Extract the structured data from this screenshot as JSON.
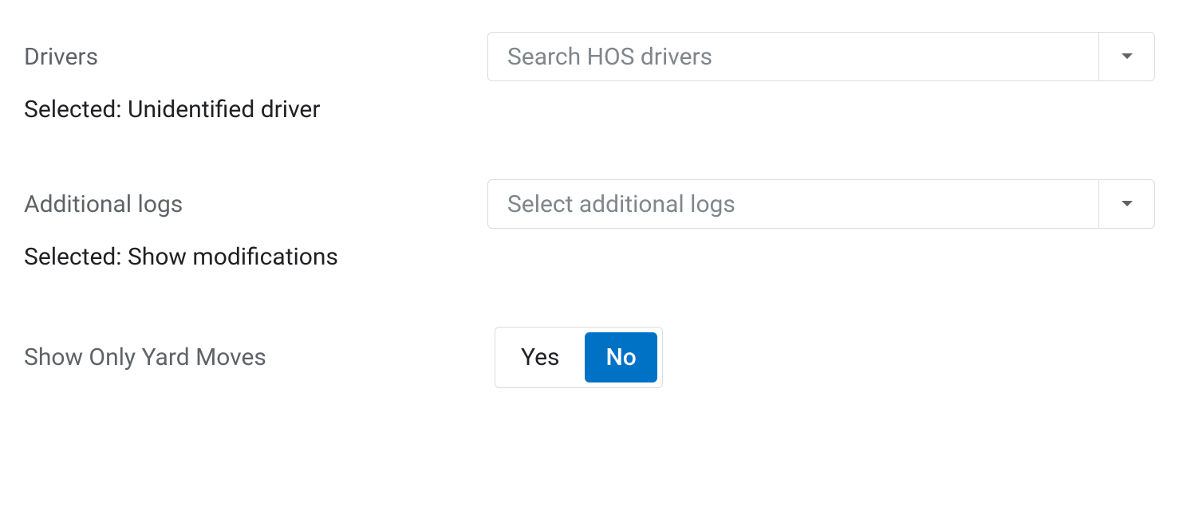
{
  "drivers": {
    "label": "Drivers",
    "placeholder": "Search HOS drivers",
    "selected_prefix": "Selected: ",
    "selected_value": "Unidentified driver"
  },
  "additional_logs": {
    "label": "Additional logs",
    "placeholder": "Select additional logs",
    "selected_prefix": "Selected: ",
    "selected_value": "Show modifications"
  },
  "yard_moves": {
    "label": "Show Only Yard Moves",
    "option_yes": "Yes",
    "option_no": "No"
  }
}
